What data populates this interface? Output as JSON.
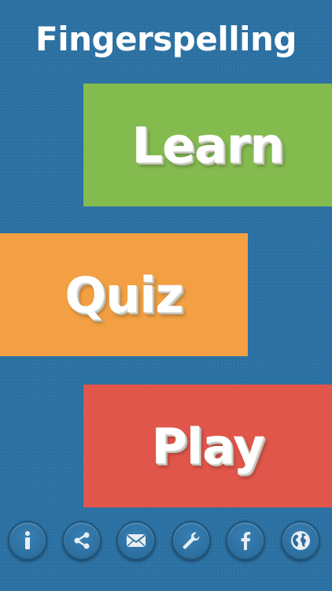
{
  "app": {
    "title": "Fingerspelling"
  },
  "menu": {
    "learn_label": "Learn",
    "quiz_label": "Quiz",
    "play_label": "Play"
  },
  "toolbar": {
    "icons": [
      "info-icon",
      "share-icon",
      "mail-icon",
      "wrench-icon",
      "facebook-icon",
      "globe-icon"
    ]
  },
  "colors": {
    "background": "#2b71a3",
    "learn": "#84bb4f",
    "quiz": "#f2a043",
    "play": "#e0564a"
  }
}
